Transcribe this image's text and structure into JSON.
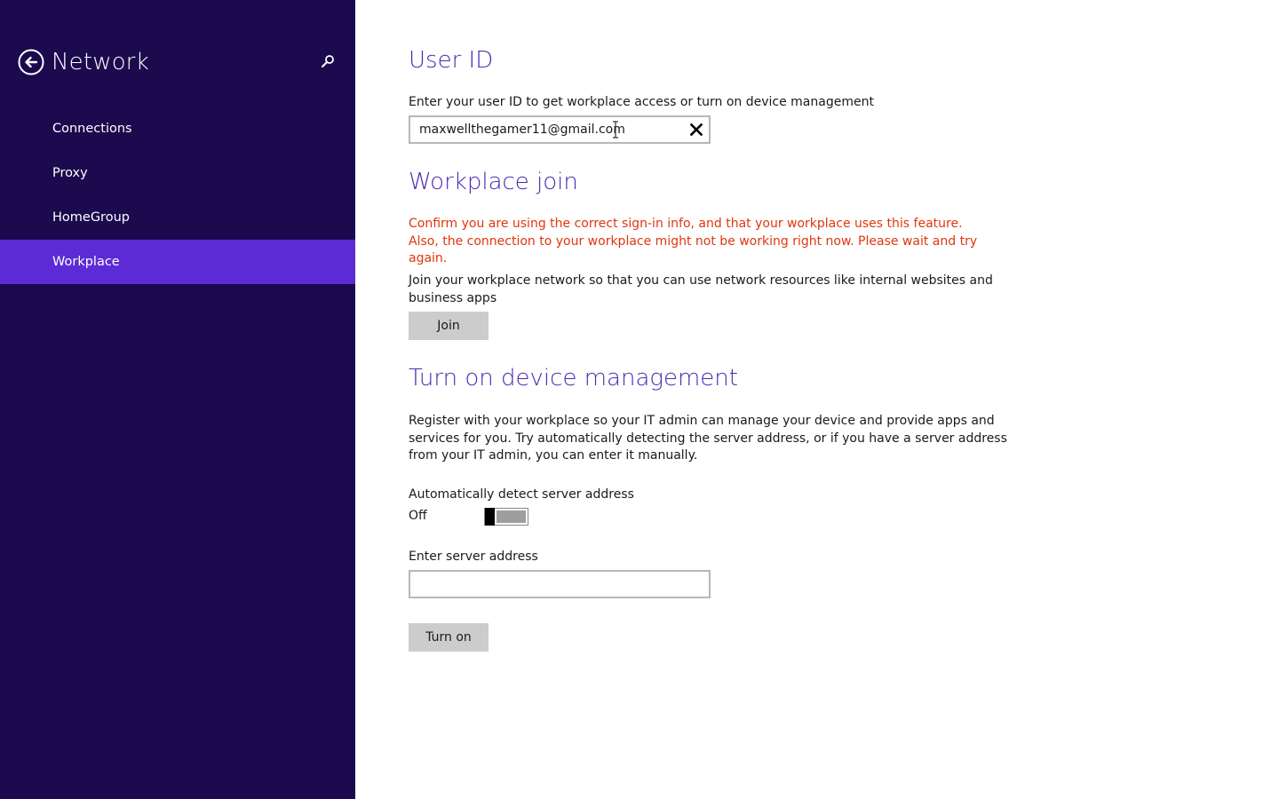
{
  "sidebar": {
    "title": "Network",
    "back_icon": "back-arrow-icon",
    "search_icon": "search-icon",
    "items": [
      {
        "label": "Connections",
        "active": false
      },
      {
        "label": "Proxy",
        "active": false
      },
      {
        "label": "HomeGroup",
        "active": false
      },
      {
        "label": "Workplace",
        "active": true
      }
    ]
  },
  "user_id": {
    "heading": "User ID",
    "description": "Enter your user ID to get workplace access or turn on device management",
    "value": "maxwellthegamer11@gmail.com"
  },
  "workplace_join": {
    "heading": "Workplace join",
    "error_lines": [
      "Confirm you are using the correct sign-in info, and that your workplace uses this feature.",
      "Also, the connection to your workplace might not be working right now. Please wait and try",
      "again."
    ],
    "description_lines": [
      "Join your workplace network so that you can use network resources like internal websites and",
      "business apps"
    ],
    "join_label": "Join"
  },
  "device_management": {
    "heading": "Turn on device management",
    "description_lines": [
      "Register with your workplace so your IT admin can manage your device and provide apps and",
      "services for you. Try automatically detecting the server address, or if you have a server address",
      "from your IT admin, you can enter it manually."
    ],
    "auto_detect_label": "Automatically detect server address",
    "toggle_state": "Off",
    "server_address_label": "Enter server address",
    "server_address_value": "",
    "turn_on_label": "Turn on"
  },
  "colors": {
    "sidebar_bg": "#1b0a4e",
    "sidebar_active": "#5c2bd6",
    "heading": "#4b2bb3",
    "error": "#e0360d",
    "button_bg": "#cccccc"
  }
}
